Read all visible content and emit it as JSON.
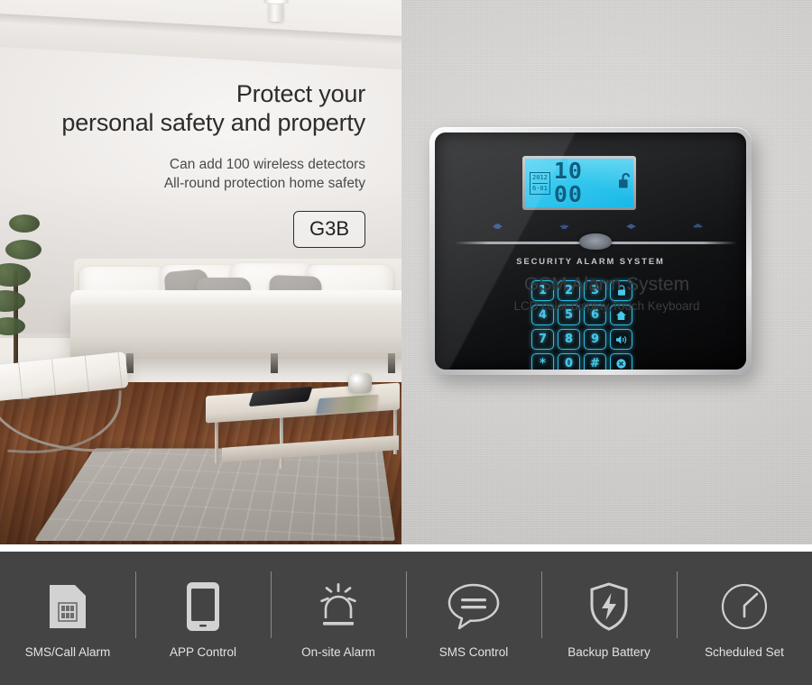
{
  "left_panel": {
    "headline_line1": "Protect your",
    "headline_line2": "personal safety and property",
    "subline1": "Can add 100 wireless detectors",
    "subline2": "All-round protection home safety",
    "model_badge": "G3B",
    "scene_alt": "modern living room with white sofa, grey pillows, rug and coffee table"
  },
  "product_panel": {
    "title": "GSM Alarm System",
    "subtitle": "LCD color display,Touch Keyboard",
    "device": {
      "brand_text": "SECURITY ALARM SYSTEM",
      "lcd": {
        "year": "2012",
        "date": "6-01",
        "time": "10 00",
        "status_icon": "unlock-icon"
      },
      "indicators": [
        "indicator-arm-icon",
        "indicator-home-icon",
        "indicator-signal-icon",
        "indicator-disarm-icon"
      ],
      "keypad": [
        {
          "label": "1",
          "type": "digit"
        },
        {
          "label": "2",
          "type": "digit"
        },
        {
          "label": "3",
          "type": "digit"
        },
        {
          "label": "",
          "type": "icon",
          "icon": "lock-icon"
        },
        {
          "label": "4",
          "type": "digit"
        },
        {
          "label": "5",
          "type": "digit"
        },
        {
          "label": "6",
          "type": "digit"
        },
        {
          "label": "",
          "type": "icon",
          "icon": "home-icon"
        },
        {
          "label": "7",
          "type": "digit"
        },
        {
          "label": "8",
          "type": "digit"
        },
        {
          "label": "9",
          "type": "digit"
        },
        {
          "label": "",
          "type": "icon",
          "icon": "speaker-icon"
        },
        {
          "label": "*",
          "type": "digit"
        },
        {
          "label": "0",
          "type": "digit"
        },
        {
          "label": "#",
          "type": "digit"
        },
        {
          "label": "",
          "type": "icon",
          "icon": "disarm-icon"
        }
      ]
    }
  },
  "features": [
    {
      "label": "SMS/Call Alarm",
      "icon": "sim-card-icon"
    },
    {
      "label": "APP Control",
      "icon": "smartphone-icon"
    },
    {
      "label": "On-site Alarm",
      "icon": "siren-icon"
    },
    {
      "label": "SMS Control",
      "icon": "speech-bubble-icon"
    },
    {
      "label": "Backup Battery",
      "icon": "shield-battery-icon"
    },
    {
      "label": "Scheduled Set",
      "icon": "clock-icon"
    }
  ],
  "colors": {
    "feature_bar_bg": "#444444",
    "feature_label": "#e3e3e3",
    "keypad_glow": "#45c9ea",
    "lcd_bg": "#34c8ee",
    "headline_text": "#2c2c2c"
  }
}
